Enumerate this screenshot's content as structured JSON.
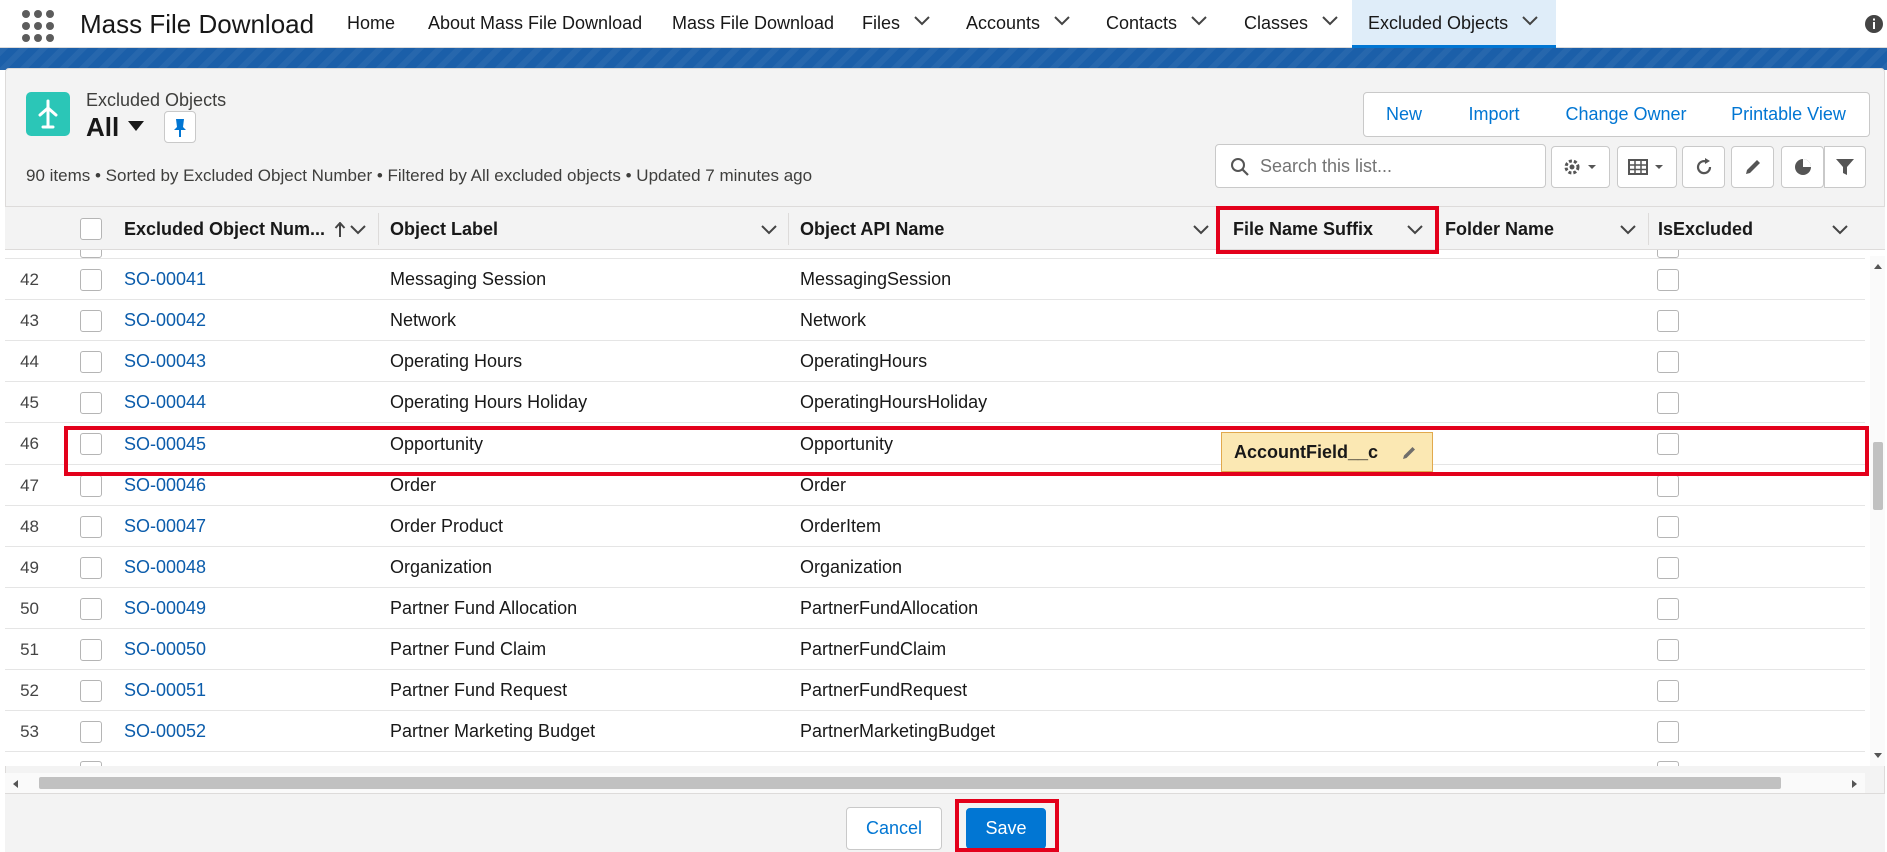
{
  "app": {
    "name": "Mass File Download"
  },
  "nav": {
    "items": [
      {
        "label": "Home"
      },
      {
        "label": "About Mass File Download"
      },
      {
        "label": "Mass File Download"
      },
      {
        "label": "Files"
      },
      {
        "label": "Accounts"
      },
      {
        "label": "Contacts"
      },
      {
        "label": "Classes"
      },
      {
        "label": "Excluded Objects"
      }
    ],
    "active": "Excluded Objects"
  },
  "list_header": {
    "object_type": "Excluded Objects",
    "view_name": "All",
    "meta": "90 items • Sorted by Excluded Object Number • Filtered by All excluded objects • Updated 7 minutes ago"
  },
  "actions": {
    "new": "New",
    "import": "Import",
    "change_owner": "Change Owner",
    "printable_view": "Printable View"
  },
  "search": {
    "placeholder": "Search this list..."
  },
  "columns": {
    "number": "Excluded Object Num...",
    "object_label": "Object Label",
    "api_name": "Object API Name",
    "suffix": "File Name Suffix",
    "folder": "Folder Name",
    "excluded": "IsExcluded"
  },
  "rows": [
    {
      "n": "42",
      "id": "SO-00041",
      "label": "Messaging Session",
      "api": "MessagingSession"
    },
    {
      "n": "43",
      "id": "SO-00042",
      "label": "Network",
      "api": "Network"
    },
    {
      "n": "44",
      "id": "SO-00043",
      "label": "Operating Hours",
      "api": "OperatingHours"
    },
    {
      "n": "45",
      "id": "SO-00044",
      "label": "Operating Hours Holiday",
      "api": "OperatingHoursHoliday"
    },
    {
      "n": "46",
      "id": "SO-00045",
      "label": "Opportunity",
      "api": "Opportunity",
      "suffix": "AccountField__c"
    },
    {
      "n": "47",
      "id": "SO-00046",
      "label": "Order",
      "api": "Order"
    },
    {
      "n": "48",
      "id": "SO-00047",
      "label": "Order Product",
      "api": "OrderItem"
    },
    {
      "n": "49",
      "id": "SO-00048",
      "label": "Organization",
      "api": "Organization"
    },
    {
      "n": "50",
      "id": "SO-00049",
      "label": "Partner Fund Allocation",
      "api": "PartnerFundAllocation"
    },
    {
      "n": "51",
      "id": "SO-00050",
      "label": "Partner Fund Claim",
      "api": "PartnerFundClaim"
    },
    {
      "n": "52",
      "id": "SO-00051",
      "label": "Partner Fund Request",
      "api": "PartnerFundRequest"
    },
    {
      "n": "53",
      "id": "SO-00052",
      "label": "Partner Marketing Budget",
      "api": "PartnerMarketingBudget"
    }
  ],
  "footer": {
    "cancel": "Cancel",
    "save": "Save"
  },
  "colors": {
    "brand": "#0176d3",
    "highlight": "#e3001b",
    "edit_bg": "#fbe8b3",
    "icon_teal": "#2bc6b7"
  }
}
